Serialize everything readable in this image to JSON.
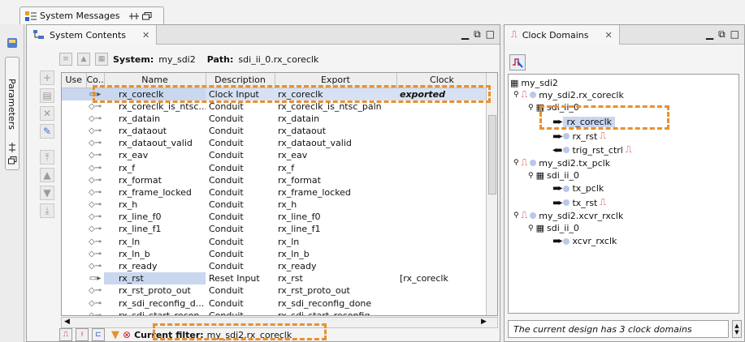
{
  "system_messages": {
    "tab_label": "System Messages"
  },
  "parameters": {
    "tab_label": "Parameters"
  },
  "system_contents": {
    "tab_label": "System Contents",
    "system_label": "System:",
    "system_name": "my_sdi2",
    "path_label": "Path:",
    "path_value": "sdi_ii_0.rx_coreclk",
    "columns": [
      "Use",
      "Co...",
      "Name",
      "Description",
      "Export",
      "Clock"
    ],
    "rows": [
      {
        "name": "rx_coreclk",
        "description": "Clock Input",
        "export": "rx_coreclk",
        "clock": "exported"
      },
      {
        "name": "rx_coreclk_is_ntsc...",
        "description": "Conduit",
        "export": "rx_coreclk_is_ntsc_paln",
        "clock": ""
      },
      {
        "name": "rx_datain",
        "description": "Conduit",
        "export": "rx_datain",
        "clock": ""
      },
      {
        "name": "rx_dataout",
        "description": "Conduit",
        "export": "rx_dataout",
        "clock": ""
      },
      {
        "name": "rx_dataout_valid",
        "description": "Conduit",
        "export": "rx_dataout_valid",
        "clock": ""
      },
      {
        "name": "rx_eav",
        "description": "Conduit",
        "export": "rx_eav",
        "clock": ""
      },
      {
        "name": "rx_f",
        "description": "Conduit",
        "export": "rx_f",
        "clock": ""
      },
      {
        "name": "rx_format",
        "description": "Conduit",
        "export": "rx_format",
        "clock": ""
      },
      {
        "name": "rx_frame_locked",
        "description": "Conduit",
        "export": "rx_frame_locked",
        "clock": ""
      },
      {
        "name": "rx_h",
        "description": "Conduit",
        "export": "rx_h",
        "clock": ""
      },
      {
        "name": "rx_line_f0",
        "description": "Conduit",
        "export": "rx_line_f0",
        "clock": ""
      },
      {
        "name": "rx_line_f1",
        "description": "Conduit",
        "export": "rx_line_f1",
        "clock": ""
      },
      {
        "name": "rx_ln",
        "description": "Conduit",
        "export": "rx_ln",
        "clock": ""
      },
      {
        "name": "rx_ln_b",
        "description": "Conduit",
        "export": "rx_ln_b",
        "clock": ""
      },
      {
        "name": "rx_ready",
        "description": "Conduit",
        "export": "rx_ready",
        "clock": ""
      },
      {
        "name": "rx_rst",
        "description": "Reset Input",
        "export": "rx_rst",
        "clock": "[rx_coreclk"
      },
      {
        "name": "rx_rst_proto_out",
        "description": "Conduit",
        "export": "rx_rst_proto_out",
        "clock": ""
      },
      {
        "name": "rx_sdi_reconfig_d...",
        "description": "Conduit",
        "export": "rx_sdi_reconfig_done",
        "clock": ""
      },
      {
        "name": "rx_sdi_start_recon...",
        "description": "Conduit",
        "export": "rx_sdi_start_reconfig",
        "clock": ""
      }
    ],
    "filter_label": "Current filter:",
    "filter_value": "my_sdi2.rx_coreclk"
  },
  "clock_domains": {
    "tab_label": "Clock Domains",
    "tree": {
      "root": "my_sdi2",
      "d1": "my_sdi2.rx_coreclk",
      "d1_inst": "sdi_ii_0",
      "d1_c1": "rx_coreclk",
      "d1_c2": "rx_rst",
      "d1_c3": "trig_rst_ctrl",
      "d2": "my_sdi2.tx_pclk",
      "d2_inst": "sdi_ii_0",
      "d2_c1": "tx_pclk",
      "d2_c2": "tx_rst",
      "d3": "my_sdi2.xcvr_rxclk",
      "d3_inst": "sdi_ii_0",
      "d3_c1": "xcvr_rxclk"
    },
    "status": "The current design has 3 clock domains"
  },
  "colors": {
    "highlight": "#e8912c",
    "selection": "#c9d7ef",
    "clock_red": "#d02020"
  }
}
